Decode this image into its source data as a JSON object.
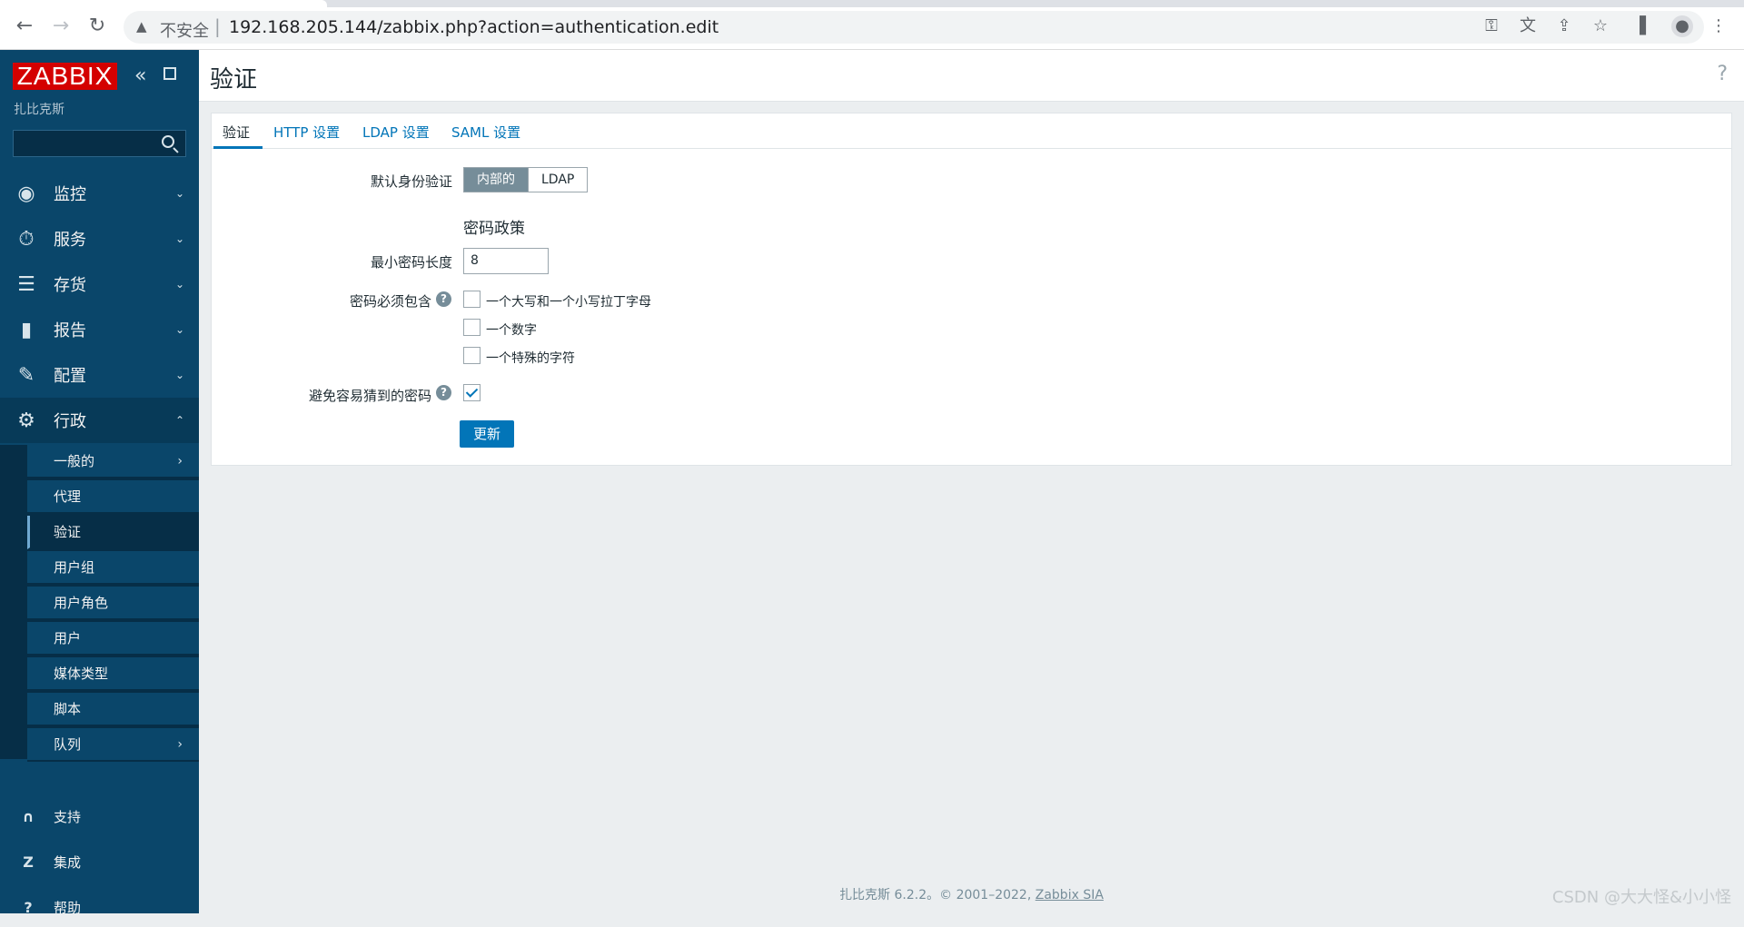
{
  "browser": {
    "insecure_label": "不安全",
    "separator": "|",
    "url": "192.168.205.144/zabbix.php?action=authentication.edit"
  },
  "sidebar": {
    "logo": "ZABBIX",
    "sub_brand": "扎比克斯",
    "search_placeholder": "",
    "menu": [
      {
        "label": "监控",
        "icon": "eye-icon"
      },
      {
        "label": "服务",
        "icon": "stopwatch-icon"
      },
      {
        "label": "存货",
        "icon": "list-icon"
      },
      {
        "label": "报告",
        "icon": "bar-chart-icon"
      },
      {
        "label": "配置",
        "icon": "wrench-icon"
      },
      {
        "label": "行政",
        "icon": "gear-icon"
      }
    ],
    "admin_submenu": [
      {
        "label": "一般的"
      },
      {
        "label": "代理"
      },
      {
        "label": "验证"
      },
      {
        "label": "用户组"
      },
      {
        "label": "用户角色"
      },
      {
        "label": "用户"
      },
      {
        "label": "媒体类型"
      },
      {
        "label": "脚本"
      },
      {
        "label": "队列"
      }
    ],
    "bottom": [
      {
        "label": "支持",
        "icon": "headset-icon"
      },
      {
        "label": "集成",
        "icon": "z-icon"
      },
      {
        "label": "帮助",
        "icon": "question-icon"
      }
    ]
  },
  "header": {
    "title": "验证",
    "help": "?"
  },
  "tabs": [
    "验证",
    "HTTP 设置",
    "LDAP 设置",
    "SAML 设置"
  ],
  "form": {
    "default_auth_label": "默认身份验证",
    "auth_options": [
      "内部的",
      "LDAP"
    ],
    "password_policy_title": "密码政策",
    "min_length_label": "最小密码长度",
    "min_length_value": "8",
    "must_contain_label": "密码必须包含",
    "must_contain_options": [
      "一个大写和一个小写拉丁字母",
      "一个数字",
      "一个特殊的字符"
    ],
    "avoid_easy_label": "避免容易猜到的密码",
    "update_button": "更新"
  },
  "footer": {
    "text": "扎比克斯 6.2.2。© 2001–2022, ",
    "link": "Zabbix SIA"
  },
  "watermark": "CSDN @大大怪&小小怪"
}
